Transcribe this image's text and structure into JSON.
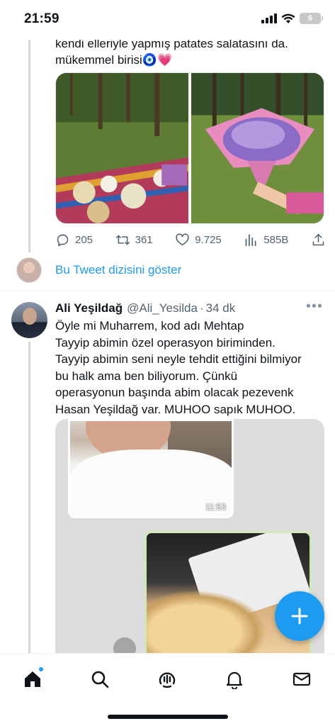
{
  "status_bar": {
    "time": "21:59",
    "battery_level": "6"
  },
  "tweet1": {
    "text_line1": "kendi elleriyle yapmış patates salatasını da.",
    "text_line2": "mükemmel birisi🧿💗",
    "actions": {
      "replies": "205",
      "retweets": "361",
      "likes": "9.725",
      "views": "585B"
    },
    "show_thread_label": "Bu Tweet dizisini göster"
  },
  "tweet2": {
    "author_name": "Ali Yeşildağ",
    "author_handle": "@Ali_Yesilda",
    "separator": "·",
    "time": "34 dk",
    "more_label": "•••",
    "body_lines": [
      "Öyle mi Muharrem, kod adı Mehtap",
      "Tayyip abimin özel operasyon biriminden.",
      "Tayyip abimin seni neyle tehdit ettiğini bilmiyor",
      "bu halk ama ben biliyorum. Çünkü",
      "operasyonun başında abim olacak pezevenk",
      "Hasan Yeşildağ var. MUHOO sapık MUHOO."
    ],
    "video_timestamp": "11:53"
  },
  "fab": {
    "icon": "compose-plus-icon",
    "label": "+"
  },
  "bottom_nav": {
    "items": [
      "home-icon",
      "search-icon",
      "spaces-icon",
      "notifications-bell-icon",
      "messages-envelope-icon"
    ]
  },
  "colors": {
    "accent": "#1d9bf0",
    "text_primary": "#0f1419",
    "text_secondary": "#536471",
    "divider": "#eff3f4"
  }
}
